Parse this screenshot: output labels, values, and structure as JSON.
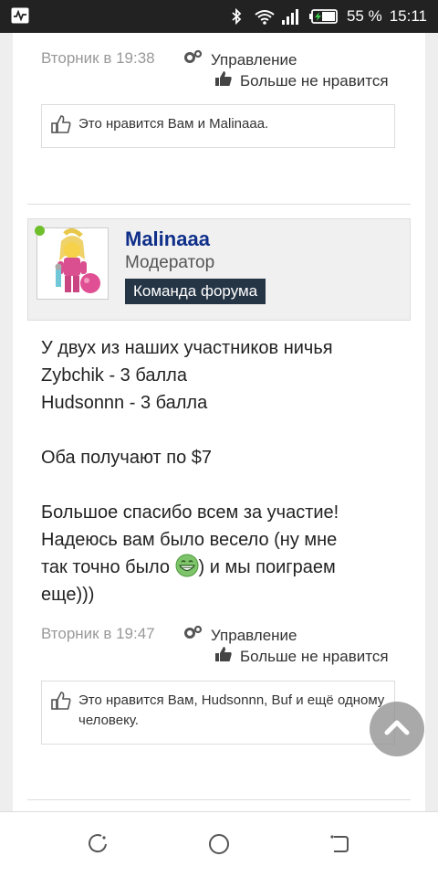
{
  "status_bar": {
    "battery_percent": "55 %",
    "time": "15:11",
    "icons": [
      "activity-icon",
      "bluetooth-icon",
      "wifi-icon",
      "signal-icon",
      "battery-icon"
    ]
  },
  "previous_post": {
    "timestamp": "Вторник в 19:38",
    "manage_label": "Управление",
    "unlike_label": "Больше не нравится",
    "likes_text": "Это нравится Вам и Malinaaa."
  },
  "post": {
    "author_name": "Malinaaa",
    "author_role": "Модератор",
    "author_badge": "Команда форума",
    "body": {
      "line1": "У двух из наших участников ничья",
      "line2": "Zybchik - 3 балла",
      "line3": "Hudsonnn - 3 балла",
      "line4": "Оба получают по $7",
      "line5": "Большое спасибо всем за участие!",
      "line6": "Надеюсь вам было весело (ну мне",
      "line7_before": "так точно было ",
      "line7_after": ") и мы поиграем",
      "line8": "еще)))"
    },
    "timestamp": "Вторник в 19:47",
    "manage_label": "Управление",
    "unlike_label": "Больше не нравится",
    "likes_text": "Это нравится Вам, Hudsonnn, Buf и ещё одному человеку."
  },
  "colors": {
    "author_name": "#0f2f8a",
    "badge_bg": "#253545",
    "online": "#6fbf2d",
    "status_bar": "#222222"
  }
}
